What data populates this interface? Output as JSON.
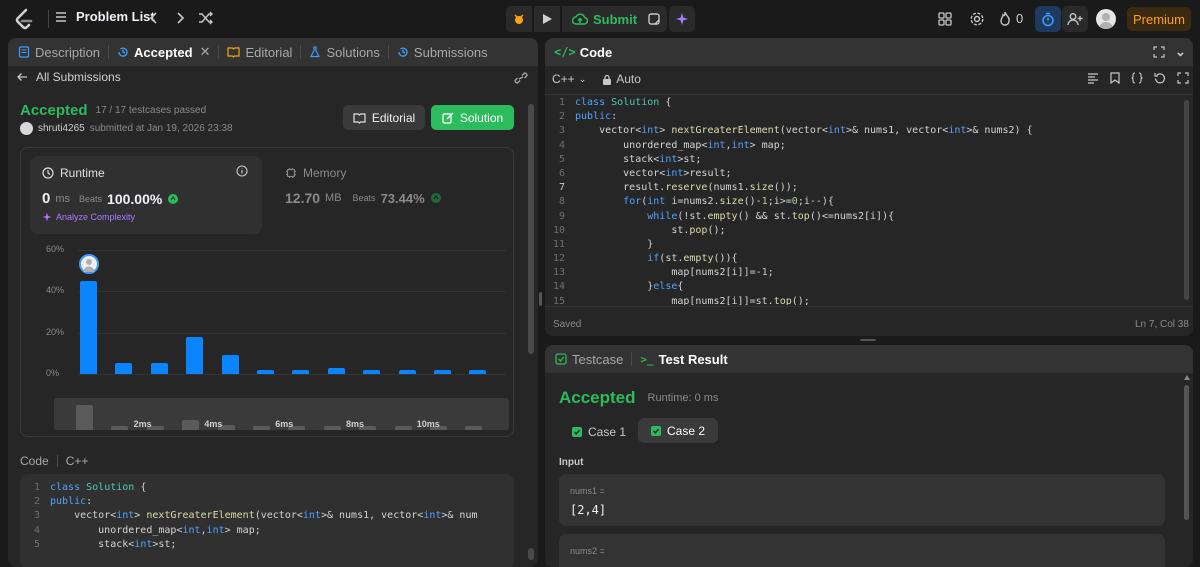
{
  "topbar": {
    "problem_list": "Problem List",
    "submit": "Submit",
    "streak_count": "0",
    "premium": "Premium"
  },
  "left": {
    "tabs": [
      {
        "label": "Description"
      },
      {
        "label": "Accepted"
      },
      {
        "label": "Editorial"
      },
      {
        "label": "Solutions"
      },
      {
        "label": "Submissions"
      }
    ],
    "all_submissions": "All Submissions",
    "status": "Accepted",
    "testcases": "17 / 17 testcases passed",
    "username": "shruti4265",
    "submitted_at": "submitted at Jan 19, 2026 23:38",
    "editorial_btn": "Editorial",
    "solution_btn": "Solution",
    "runtime": {
      "label": "Runtime",
      "value": "0",
      "unit": "ms",
      "beats_label": "Beats",
      "beats": "100.00%",
      "analyze": "Analyze Complexity"
    },
    "memory": {
      "label": "Memory",
      "value": "12.70",
      "unit": "MB",
      "beats_label": "Beats",
      "beats": "73.44%"
    },
    "code_label": "Code",
    "lang": "C++"
  },
  "chart_data": {
    "type": "bar",
    "ylim": [
      0,
      60
    ],
    "yticks": [
      "60%",
      "40%",
      "20%",
      "0%"
    ],
    "xticks": [
      "2ms",
      "4ms",
      "6ms",
      "8ms",
      "10ms"
    ],
    "values": [
      45,
      5.5,
      5.5,
      18,
      9,
      2,
      2,
      3,
      2,
      2,
      2,
      2
    ],
    "color": "#0a84ff",
    "highlight_index": 0
  },
  "editor": {
    "title": "Code",
    "lang": "C++",
    "mode": "Auto",
    "status": "Saved",
    "cursor": "Ln 7, Col 38"
  },
  "results": {
    "tab_testcase": "Testcase",
    "tab_result": "Test Result",
    "status": "Accepted",
    "runtime": "Runtime: 0 ms",
    "case1": "Case 1",
    "case2": "Case 2",
    "input_label": "Input",
    "nums1_label": "nums1 =",
    "nums1_value": "[2,4]",
    "nums2_label": "nums2 ="
  }
}
